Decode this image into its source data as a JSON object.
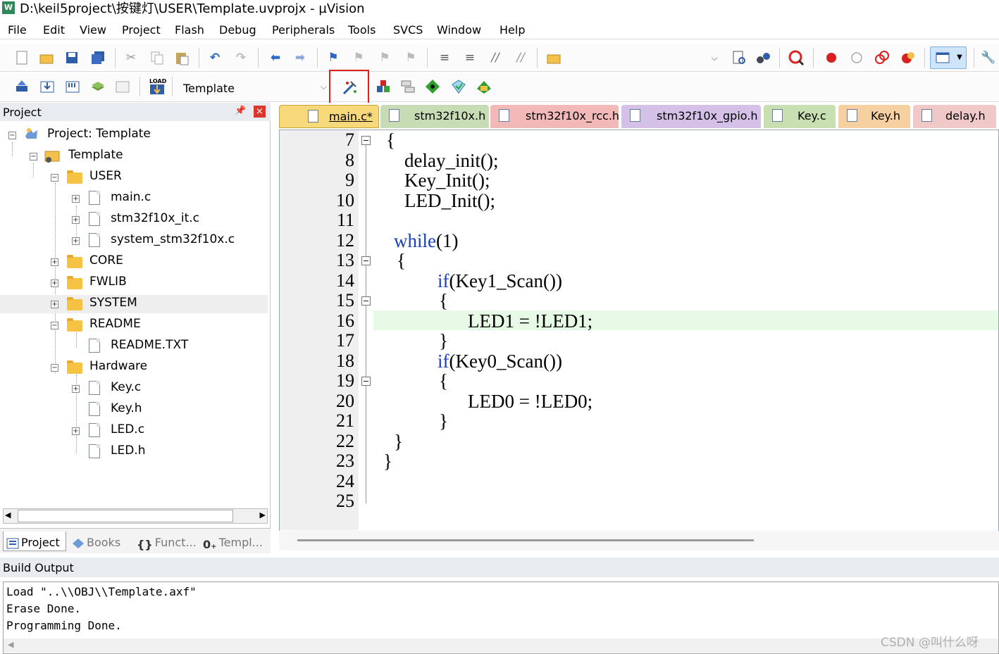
{
  "window": {
    "title": "D:\\keil5project\\按键灯\\USER\\Template.uvprojx - µVision",
    "app_icon": "keil-uvision-icon"
  },
  "menu": [
    "File",
    "Edit",
    "View",
    "Project",
    "Flash",
    "Debug",
    "Peripherals",
    "Tools",
    "SVCS",
    "Window",
    "Help"
  ],
  "toolbar2": {
    "target_name": "Template"
  },
  "project_pane": {
    "title": "Project",
    "tree": [
      {
        "label": "Project: Template",
        "icon": "project-icon"
      },
      {
        "label": "Template",
        "icon": "folder-icon"
      },
      {
        "label": "USER",
        "icon": "folder-icon"
      },
      {
        "label": "main.c",
        "icon": "file-icon"
      },
      {
        "label": "stm32f10x_it.c",
        "icon": "file-icon"
      },
      {
        "label": "system_stm32f10x.c",
        "icon": "file-icon"
      },
      {
        "label": "CORE",
        "icon": "folder-icon"
      },
      {
        "label": "FWLIB",
        "icon": "folder-icon"
      },
      {
        "label": "SYSTEM",
        "icon": "folder-icon"
      },
      {
        "label": "README",
        "icon": "folder-icon"
      },
      {
        "label": "README.TXT",
        "icon": "file-icon"
      },
      {
        "label": "Hardware",
        "icon": "folder-icon"
      },
      {
        "label": "Key.c",
        "icon": "file-icon"
      },
      {
        "label": "Key.h",
        "icon": "file-icon"
      },
      {
        "label": "LED.c",
        "icon": "file-icon"
      },
      {
        "label": "LED.h",
        "icon": "file-icon"
      }
    ],
    "tabs": [
      {
        "label": "Project",
        "icon": "project-tab-icon"
      },
      {
        "label": "Books",
        "icon": "books-icon"
      },
      {
        "label": "Funct...",
        "icon": "functions-icon"
      },
      {
        "label": "Templ...",
        "icon": "templates-icon"
      }
    ]
  },
  "editor": {
    "tabs": [
      {
        "label": "main.c*",
        "color": "#f7d87a"
      },
      {
        "label": "stm32f10x.h",
        "color": "#c7dcb4"
      },
      {
        "label": "stm32f10x_rcc.h",
        "color": "#f3b9b9"
      },
      {
        "label": "stm32f10x_gpio.h",
        "color": "#d5c0e8"
      },
      {
        "label": "Key.c",
        "color": "#c8dfb2"
      },
      {
        "label": "Key.h",
        "color": "#f6d0a0"
      },
      {
        "label": "delay.h",
        "color": "#f0c8c8"
      }
    ],
    "line_numbers": [
      "7",
      "8",
      "9",
      "10",
      "11",
      "12",
      "13",
      "14",
      "15",
      "16",
      "17",
      "18",
      "19",
      "20",
      "21",
      "22",
      "23",
      "24",
      "25"
    ],
    "code": {
      "l7": "{",
      "l8": "delay_init();",
      "l9": "Key_Init();",
      "l10": "LED_Init();",
      "l12_kw": "while",
      "l12_rest": "(1)",
      "l13": "{",
      "l14_kw": "if",
      "l14_rest": "(Key1_Scan())",
      "l15": "{",
      "l16": "LED1 = !LED1;",
      "l17": "}",
      "l18_kw": "if",
      "l18_rest": "(Key0_Scan())",
      "l19": "{",
      "l20": "LED0 = !LED0;",
      "l21": "}",
      "l22": "}",
      "l23": "}"
    }
  },
  "build_output": {
    "title": "Build Output",
    "lines": [
      "Load \"..\\\\OBJ\\\\Template.axf\"",
      "Erase Done.",
      "Programming Done."
    ]
  },
  "watermark": "CSDN @叫什么呀",
  "colors": {
    "highlight_box": "#e02020",
    "keyword": "#1a3fb8",
    "current_line": "#e6fae6",
    "active_tab": "#f7d87a"
  }
}
